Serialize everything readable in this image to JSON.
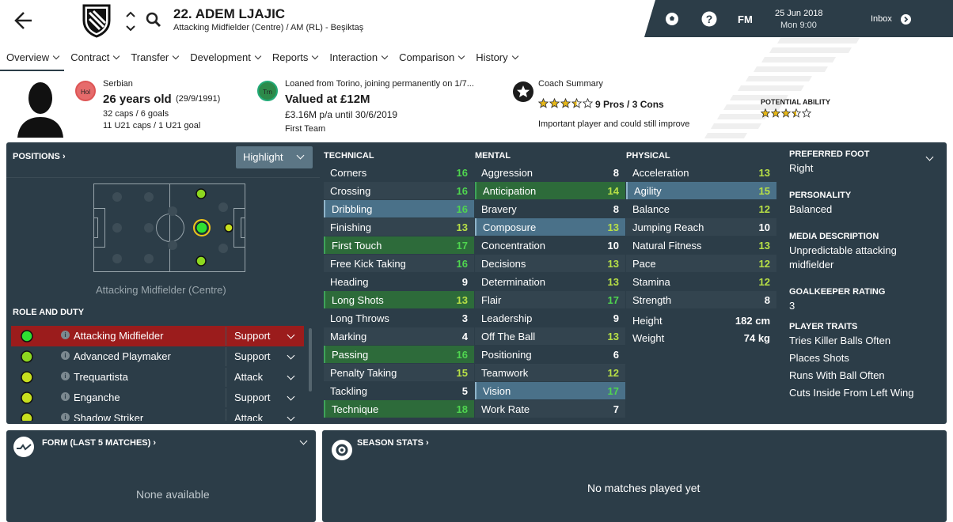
{
  "player": {
    "name": "22. ADEM LJAJIC",
    "role": "Attacking Midfielder (Centre) / AM (RL) - Beşiktaş"
  },
  "topbar": {
    "fm": "FM",
    "date": "25 Jun 2018",
    "time": "Mon 9:00",
    "inbox": "Inbox"
  },
  "nav": [
    "Overview",
    "Contract",
    "Transfer",
    "Development",
    "Reports",
    "Interaction",
    "Comparison",
    "History"
  ],
  "bio": {
    "nationality": "Serbian",
    "nat_code": "Hol",
    "age": "26 years old",
    "dob": "(29/9/1991)",
    "caps": "32 caps / 6 goals",
    "u21": "11 U21 caps / 1 U21 goal"
  },
  "value": {
    "loan": "Loaned from Torino, joining permanently on 1/7...",
    "club_code": "Trn",
    "value": "Valued at £12M",
    "wage": "£3.16M p/a until 30/6/2019",
    "squad": "First Team"
  },
  "coach": {
    "title": "Coach Summary",
    "rating_stars": 3.5,
    "pros_cons": "9 Pros / 3 Cons",
    "comment": "Important player and could still improve",
    "potential_label": "POTENTIAL ABILITY",
    "potential_stars": 3.5
  },
  "positions": {
    "title": "POSITIONS",
    "button": "Highlight",
    "caption": "Attacking Midfielder (Centre)"
  },
  "role_duty": {
    "title": "ROLE AND DUTY",
    "rows": [
      {
        "role": "Attacking Midfielder",
        "duty": "Support",
        "color": "#2ee032"
      },
      {
        "role": "Advanced Playmaker",
        "duty": "Support",
        "color": "#8ed81f"
      },
      {
        "role": "Trequartista",
        "duty": "Attack",
        "color": "#c7df1e"
      },
      {
        "role": "Enganche",
        "duty": "Support",
        "color": "#c7df1e"
      },
      {
        "role": "Shadow Striker",
        "duty": "Attack",
        "color": "#c7df1e"
      }
    ]
  },
  "technical": {
    "title": "TECHNICAL",
    "attrs": [
      [
        "Corners",
        16
      ],
      [
        "Crossing",
        16
      ],
      [
        "Dribbling",
        16
      ],
      [
        "Finishing",
        13
      ],
      [
        "First Touch",
        17
      ],
      [
        "Free Kick Taking",
        16
      ],
      [
        "Heading",
        9
      ],
      [
        "Long Shots",
        13
      ],
      [
        "Long Throws",
        3
      ],
      [
        "Marking",
        4
      ],
      [
        "Passing",
        16
      ],
      [
        "Penalty Taking",
        15
      ],
      [
        "Tackling",
        5
      ],
      [
        "Technique",
        18
      ]
    ]
  },
  "mental": {
    "title": "MENTAL",
    "attrs": [
      [
        "Aggression",
        8
      ],
      [
        "Anticipation",
        14
      ],
      [
        "Bravery",
        8
      ],
      [
        "Composure",
        13
      ],
      [
        "Concentration",
        10
      ],
      [
        "Decisions",
        13
      ],
      [
        "Determination",
        13
      ],
      [
        "Flair",
        17
      ],
      [
        "Leadership",
        9
      ],
      [
        "Off The Ball",
        13
      ],
      [
        "Positioning",
        6
      ],
      [
        "Teamwork",
        12
      ],
      [
        "Vision",
        17
      ],
      [
        "Work Rate",
        7
      ]
    ]
  },
  "physical": {
    "title": "PHYSICAL",
    "attrs": [
      [
        "Acceleration",
        13
      ],
      [
        "Agility",
        15
      ],
      [
        "Balance",
        12
      ],
      [
        "Jumping Reach",
        10
      ],
      [
        "Natural Fitness",
        13
      ],
      [
        "Pace",
        12
      ],
      [
        "Stamina",
        12
      ],
      [
        "Strength",
        8
      ]
    ],
    "height_label": "Height",
    "height": "182 cm",
    "weight_label": "Weight",
    "weight": "74 kg"
  },
  "side": [
    {
      "h": "PREFERRED FOOT",
      "v": [
        "Right"
      ]
    },
    {
      "h": "PERSONALITY",
      "v": [
        "Balanced"
      ]
    },
    {
      "h": "MEDIA DESCRIPTION",
      "v": [
        "Unpredictable attacking",
        "midfielder"
      ]
    },
    {
      "h": "GOALKEEPER RATING",
      "v": [
        "3"
      ]
    },
    {
      "h": "PLAYER TRAITS",
      "v": [
        "Tries Killer Balls Often",
        "Places Shots",
        "Runs With Ball Often",
        "Cuts Inside From Left Wing"
      ]
    }
  ],
  "form": {
    "title": "FORM (LAST 5 MATCHES)",
    "empty": "None available"
  },
  "season": {
    "title": "SEASON STATS",
    "empty": "No matches played yet"
  },
  "colors": {
    "panel": "#2c3d48",
    "green_hl": "#2d6b3a",
    "blue_hl": "#4a7189",
    "role_sel": "#9b1c1c"
  }
}
